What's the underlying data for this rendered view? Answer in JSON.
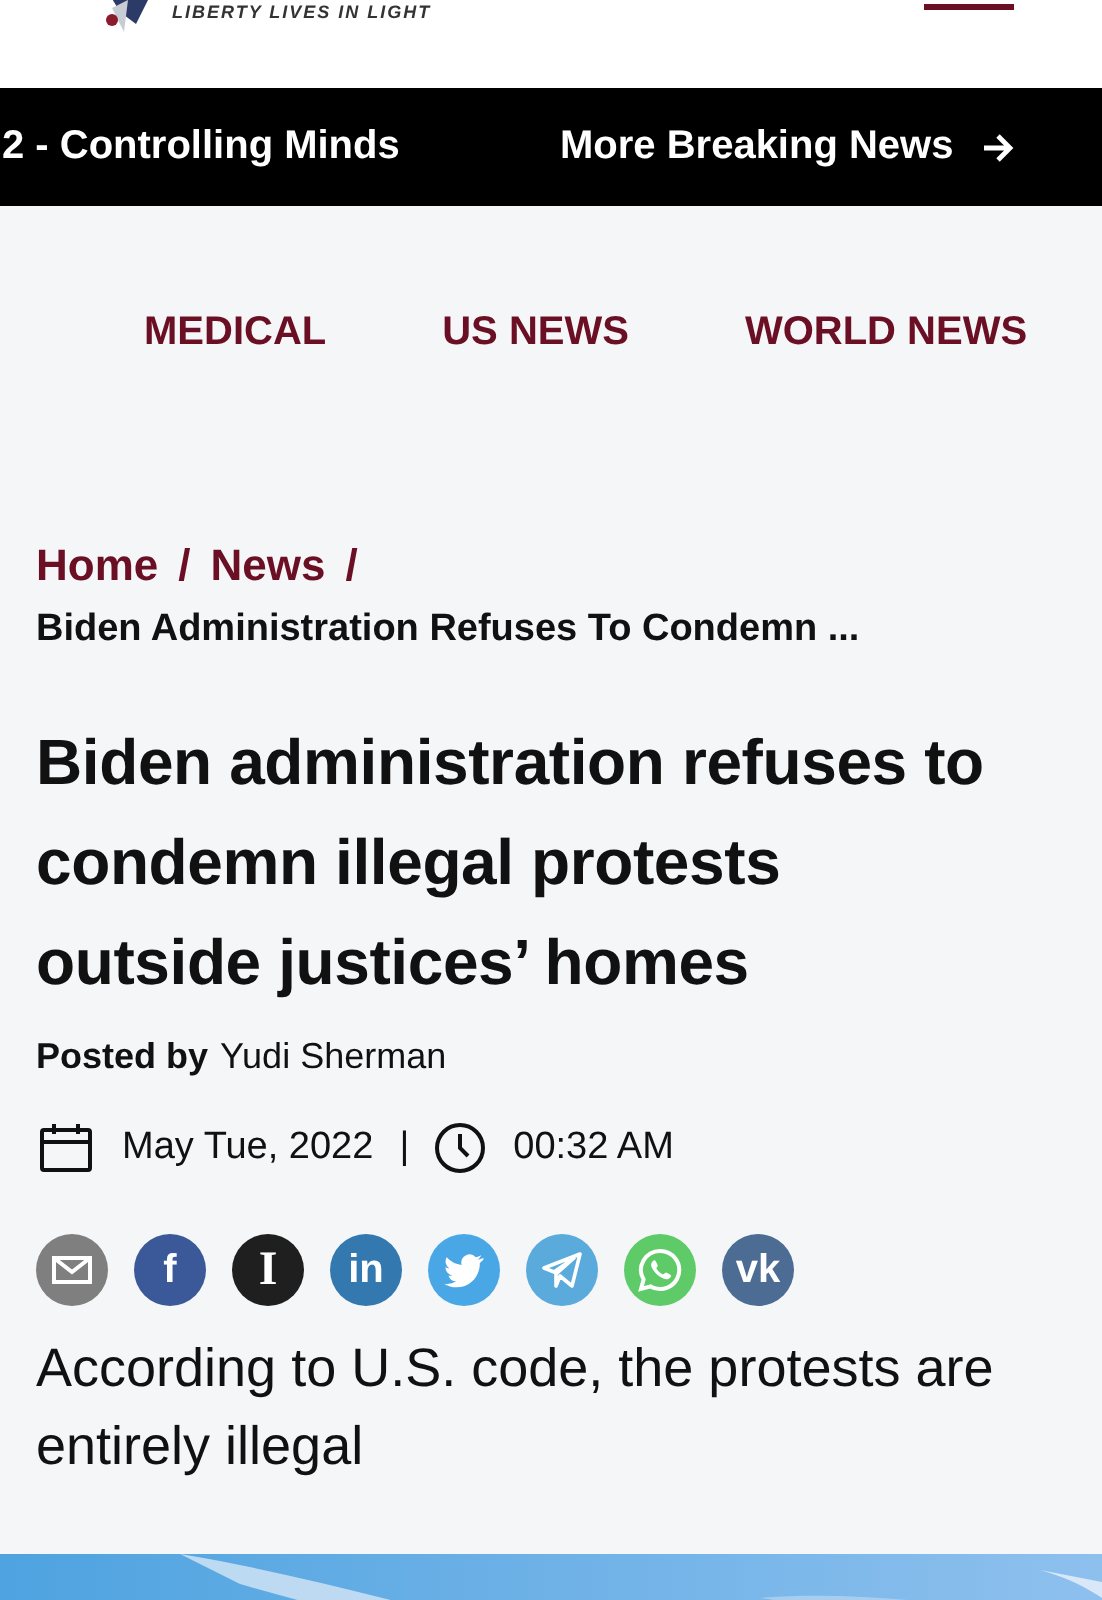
{
  "header": {
    "tagline": "LIBERTY LIVES IN LIGHT"
  },
  "ticker": {
    "headline": "2 - Controlling Minds",
    "more_link": "More Breaking News"
  },
  "categories": [
    {
      "label": "MEDICAL"
    },
    {
      "label": "US NEWS"
    },
    {
      "label": "WORLD NEWS"
    }
  ],
  "breadcrumb": {
    "links": [
      "Home",
      "News"
    ],
    "separator": "/",
    "current": "Biden Administration Refuses To Condemn ..."
  },
  "article": {
    "title": "Biden administration refuses to condemn illegal protests outside justices’ homes",
    "posted_label": "Posted by",
    "author": "Yudi Sherman",
    "date": "May Tue, 2022",
    "divider": "|",
    "time": "00:32 AM",
    "share": [
      {
        "kind": "email",
        "color": "#7f7f7f"
      },
      {
        "kind": "glyph",
        "glyph": "f",
        "color": "#3b5998"
      },
      {
        "kind": "serif",
        "glyph": "I",
        "color": "#1f1f1f"
      },
      {
        "kind": "glyph",
        "glyph": "in",
        "color": "#3379b0"
      },
      {
        "kind": "bird",
        "color": "#4aa7e6"
      },
      {
        "kind": "plane",
        "color": "#5aaadc"
      },
      {
        "kind": "phone",
        "color": "#5ecb68"
      },
      {
        "kind": "glyph",
        "glyph": "vk",
        "color": "#4c6c94"
      }
    ],
    "subtitle": "According to U.S. code, the protests are entirely illegal"
  }
}
